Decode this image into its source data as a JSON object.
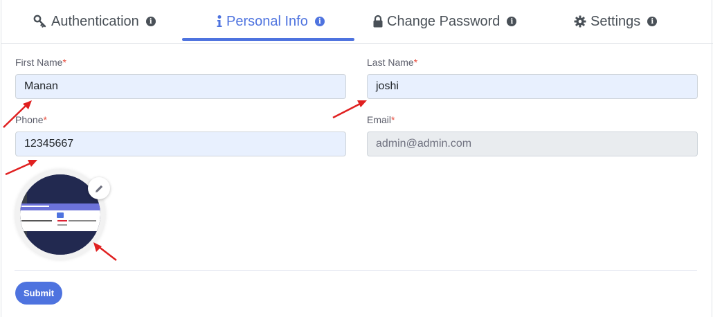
{
  "tabs": [
    {
      "label": "Authentication",
      "icon": "key-icon",
      "active": false
    },
    {
      "label": "Personal Info",
      "icon": "info-icon",
      "active": true
    },
    {
      "label": "Change Password",
      "icon": "lock-icon",
      "active": false
    },
    {
      "label": "Settings",
      "icon": "gear-icon",
      "active": false
    }
  ],
  "info_glyph": "i",
  "form": {
    "first_name": {
      "label": "First Name",
      "required": "*",
      "value": "Manan"
    },
    "last_name": {
      "label": "Last Name",
      "required": "*",
      "value": "joshi"
    },
    "phone": {
      "label": "Phone",
      "required": "*",
      "value": "12345667"
    },
    "email": {
      "label": "Email",
      "required": "*",
      "value": "admin@admin.com",
      "disabled": true
    }
  },
  "avatar": {
    "edit_icon": "pencil-icon"
  },
  "submit_label": "Submit",
  "colors": {
    "accent": "#4e73df",
    "required": "#e74a3b",
    "annotation_arrow": "#e02020"
  }
}
